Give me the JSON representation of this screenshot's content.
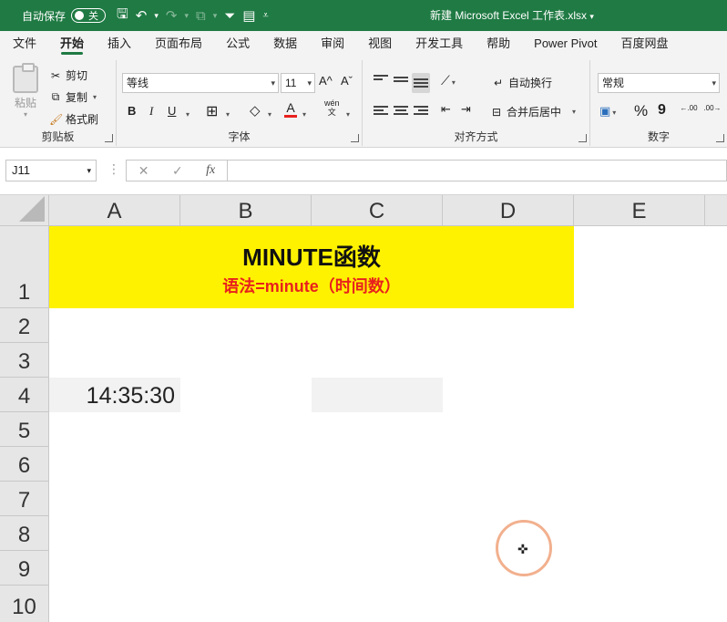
{
  "titlebar": {
    "autosave_label": "自动保存",
    "autosave_state": "关",
    "doc_title": "新建 Microsoft Excel 工作表.xlsx",
    "caret": "⌄"
  },
  "tabs": [
    "文件",
    "开始",
    "插入",
    "页面布局",
    "公式",
    "数据",
    "审阅",
    "视图",
    "开发工具",
    "帮助",
    "Power Pivot",
    "百度网盘"
  ],
  "active_tab": "开始",
  "ribbon": {
    "clipboard": {
      "paste_label": "粘贴",
      "cut_label": "剪切",
      "copy_label": "复制",
      "format_painter_label": "格式刷",
      "group_label": "剪贴板"
    },
    "font": {
      "font_name": "等线",
      "font_size": "11",
      "bold": "B",
      "italic": "I",
      "underline": "U",
      "grow": "A^",
      "shrink": "Aˇ",
      "font_color_glyph": "A",
      "phonetic_top": "wén",
      "phonetic_bottom": "文",
      "group_label": "字体",
      "font_color": "#e8211d"
    },
    "alignment": {
      "wrap_label": "自动换行",
      "merge_label": "合并后居中",
      "group_label": "对齐方式"
    },
    "number": {
      "format": "常规",
      "percent": "%",
      "comma": "9",
      "inc_decimal": "←.00",
      "dec_decimal": ".00→",
      "group_label": "数字"
    }
  },
  "formula_bar": {
    "name_box": "J11",
    "cancel": "✕",
    "confirm": "✓",
    "fx": "fx",
    "formula": ""
  },
  "grid": {
    "columns": [
      "A",
      "B",
      "C",
      "D",
      "E"
    ],
    "rows": [
      "1",
      "2",
      "3",
      "4",
      "5",
      "6",
      "7",
      "8",
      "9",
      "10"
    ],
    "title_cell": "MINUTE函数",
    "subtitle_cell": "语法=minute（时间数）",
    "a4_value": "14:35:30",
    "title_fill": "#fff200",
    "subtitle_color": "#e8211d"
  }
}
